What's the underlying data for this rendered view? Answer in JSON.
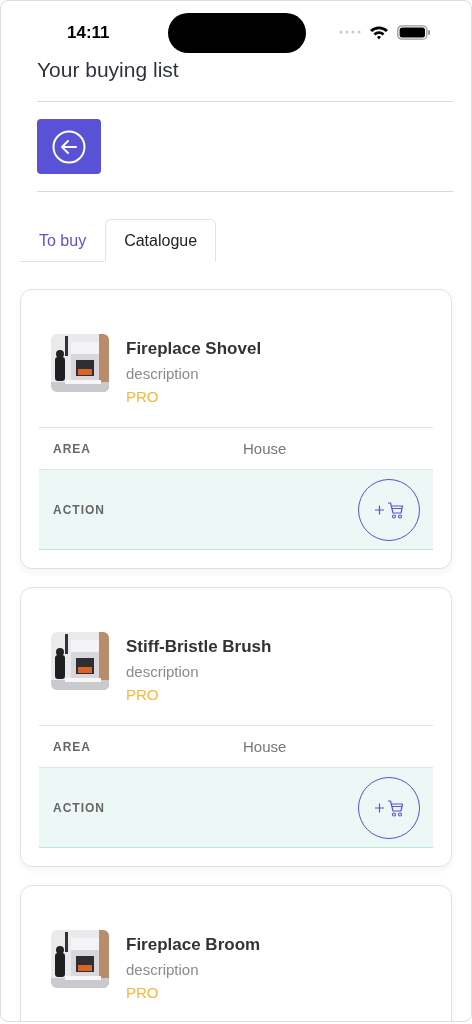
{
  "status_bar": {
    "time": "14:11"
  },
  "title": "Your buying list",
  "tabs": [
    {
      "label": "To buy",
      "selected": false
    },
    {
      "label": "Catalogue",
      "selected": true
    }
  ],
  "items": [
    {
      "name": "Fireplace Shovel",
      "description": "description",
      "tier": "PRO",
      "area_label": "AREA",
      "area": "House",
      "action_label": "ACTION"
    },
    {
      "name": "Stiff-Bristle Brush",
      "description": "description",
      "tier": "PRO",
      "area_label": "AREA",
      "area": "House",
      "action_label": "ACTION"
    },
    {
      "name": "Fireplace Broom",
      "description": "description",
      "tier": "PRO"
    }
  ]
}
